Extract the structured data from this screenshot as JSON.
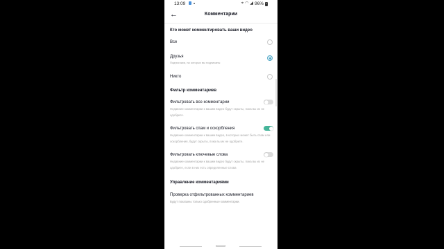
{
  "status_bar": {
    "time": "13:09",
    "battery": "96%"
  },
  "header": {
    "back_icon": "arrow-left-icon",
    "title": "Комментарии"
  },
  "who_can_comment": {
    "title": "Кто может комментировать ваши видео",
    "options": [
      {
        "label": "Все",
        "sublabel": "",
        "selected": false
      },
      {
        "label": "Друзья",
        "sublabel": "Подписчики, на которых вы подписаны",
        "selected": true
      },
      {
        "label": "Никто",
        "sublabel": "",
        "selected": false
      }
    ]
  },
  "comment_filter": {
    "title": "Фильтр комментариев",
    "items": [
      {
        "label": "Фильтровать все комментарии",
        "description": "Недавние комментарии к вашим видео будут скрыты, пока вы их не одобрите.",
        "enabled": false
      },
      {
        "label": "Фильтровать спам и оскорбления",
        "description": "Недавние комментарии к вашим видео, в которых может быть спам или оскорбления, будут скрыты, пока вы их не одобрите.",
        "enabled": true
      },
      {
        "label": "Фильтровать ключевые слова",
        "description": "Недавние комментарии к вашим видео будут скрыты, пока вы их не одобрите, если в них есть определенные слова",
        "enabled": false
      }
    ]
  },
  "comment_management": {
    "title": "Управление комментариями",
    "item_label": "Проверка отфильтрованных комментариев",
    "item_description": "Будут показаны только одобренные комментарии."
  },
  "colors": {
    "toggle_on": "#45b59a",
    "radio_selected": "#53a8c6"
  }
}
